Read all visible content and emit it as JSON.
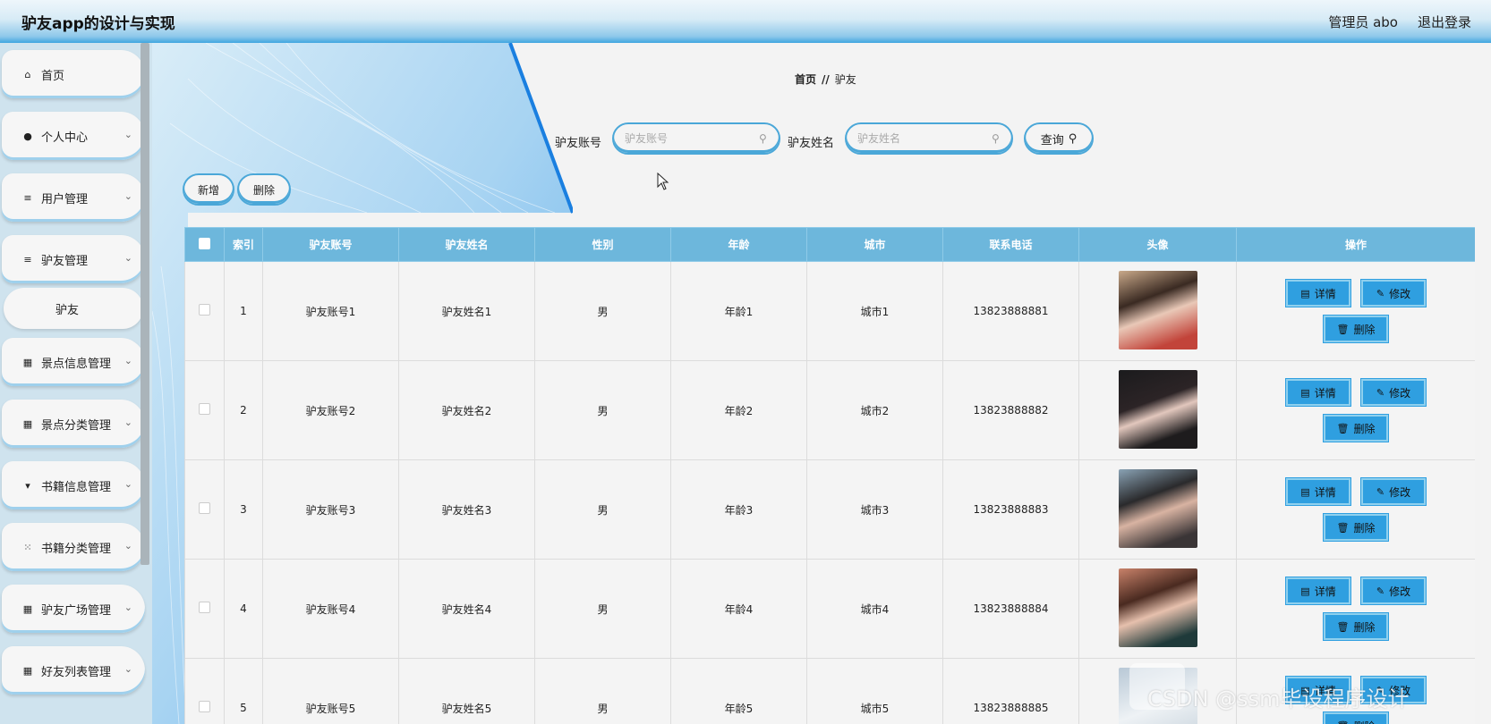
{
  "header": {
    "title": "驴友app的设计与实现",
    "user": "管理员 abo",
    "logout": "退出登录"
  },
  "sidebar": {
    "items": [
      {
        "label": "首页",
        "icon": "home-icon"
      },
      {
        "label": "个人中心",
        "icon": "user-icon"
      },
      {
        "label": "用户管理",
        "icon": "list-icon"
      },
      {
        "label": "驴友管理",
        "icon": "list-icon"
      },
      {
        "label": "驴友",
        "icon": ""
      },
      {
        "label": "景点信息管理",
        "icon": "grid-icon"
      },
      {
        "label": "景点分类管理",
        "icon": "grid-icon"
      },
      {
        "label": "书籍信息管理",
        "icon": "monitor-icon"
      },
      {
        "label": "书籍分类管理",
        "icon": "apps-icon"
      },
      {
        "label": "驴友广场管理",
        "icon": "grid-icon"
      },
      {
        "label": "好友列表管理",
        "icon": "grid-icon"
      }
    ]
  },
  "breadcrumb": {
    "home": "首页",
    "separator": "//",
    "current": "驴友"
  },
  "search": {
    "account_label": "驴友账号",
    "account_placeholder": "驴友账号",
    "name_label": "驴友姓名",
    "name_placeholder": "驴友姓名",
    "query_label": "查询"
  },
  "toolbar": {
    "add_label": "新增",
    "delete_label": "删除"
  },
  "table": {
    "columns": [
      "索引",
      "驴友账号",
      "驴友姓名",
      "性别",
      "年龄",
      "城市",
      "联系电话",
      "头像",
      "操作"
    ],
    "rows": [
      {
        "index": "1",
        "account": "驴友账号1",
        "name": "驴友姓名1",
        "gender": "男",
        "age": "年龄1",
        "city": "城市1",
        "phone": "13823888881"
      },
      {
        "index": "2",
        "account": "驴友账号2",
        "name": "驴友姓名2",
        "gender": "男",
        "age": "年龄2",
        "city": "城市2",
        "phone": "13823888882"
      },
      {
        "index": "3",
        "account": "驴友账号3",
        "name": "驴友姓名3",
        "gender": "男",
        "age": "年龄3",
        "city": "城市3",
        "phone": "13823888883"
      },
      {
        "index": "4",
        "account": "驴友账号4",
        "name": "驴友姓名4",
        "gender": "男",
        "age": "年龄4",
        "city": "城市4",
        "phone": "13823888884"
      },
      {
        "index": "5",
        "account": "驴友账号5",
        "name": "驴友姓名5",
        "gender": "男",
        "age": "年龄5",
        "city": "城市5",
        "phone": "13823888885"
      }
    ],
    "actions": {
      "detail": "详情",
      "edit": "修改",
      "delete": "删除"
    }
  },
  "watermark": "CSDN @ssm毕设程序设计",
  "colors": {
    "accent": "#2f9fe0",
    "header_th": "#6db7dc",
    "sidebar_bg": "#cfe3ee"
  }
}
